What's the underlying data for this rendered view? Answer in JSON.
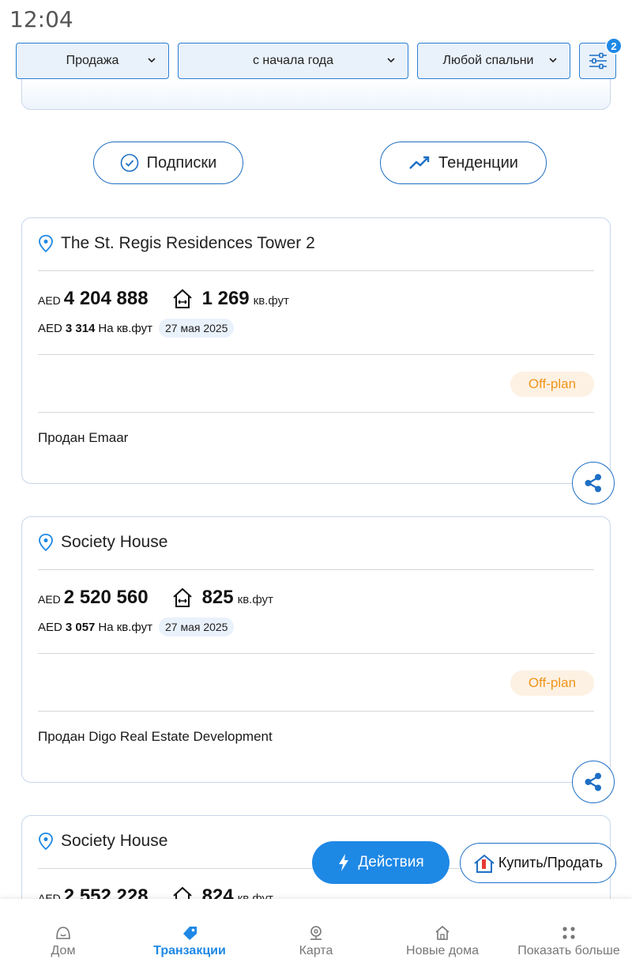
{
  "status_bar": {
    "time": "12:04"
  },
  "filters": {
    "deal_type": "Продажа",
    "period": "с начала года",
    "bedrooms": "Любой спальни",
    "active_count": "2"
  },
  "actions": {
    "subscriptions": "Подписки",
    "trends": "Тенденции"
  },
  "transactions": [
    {
      "name": "The St. Regis Residences Tower 2",
      "currency": "AED",
      "price": "4 204 888",
      "area": "1 269",
      "area_unit": "кв.фут",
      "ppsf_currency": "AED",
      "ppsf": "3 314",
      "ppsf_label": "На кв.фут",
      "date": "27 мая 2025",
      "status": "Off-plan",
      "seller": "Продан Emaar"
    },
    {
      "name": "Society House",
      "currency": "AED",
      "price": "2 520 560",
      "area": "825",
      "area_unit": "кв.фут",
      "ppsf_currency": "AED",
      "ppsf": "3 057",
      "ppsf_label": "На кв.фут",
      "date": "27 мая 2025",
      "status": "Off-plan",
      "seller": "Продан Digo Real Estate Development"
    },
    {
      "name": "Society House",
      "currency": "AED",
      "price": "2 552 228",
      "area": "824",
      "area_unit": "кв.фут"
    }
  ],
  "fab": {
    "actions": "Действия",
    "buy_sell": "Купить/Продать"
  },
  "bottom_nav": [
    {
      "label": "Дом",
      "icon": "home-outline-icon"
    },
    {
      "label": "Транзакции",
      "icon": "tag-icon",
      "active": true
    },
    {
      "label": "Карта",
      "icon": "map-pin-icon"
    },
    {
      "label": "Новые дома",
      "icon": "house-icon"
    },
    {
      "label": "Показать больше",
      "icon": "dots-grid-icon"
    }
  ],
  "colors": {
    "accent": "#1e88e5",
    "offplan_text": "#f0961c",
    "offplan_bg": "#fdf1e3",
    "chip_bg": "#e9f1fb"
  }
}
